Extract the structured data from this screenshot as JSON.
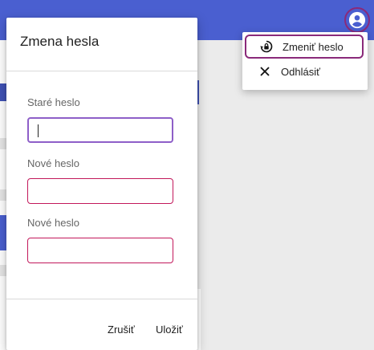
{
  "app": {
    "title": "",
    "account_icon": "account-circle-icon"
  },
  "dialog": {
    "title": "Zmena hesla",
    "fields": [
      {
        "label": "Staré heslo",
        "value": ""
      },
      {
        "label": "Nové heslo",
        "value": ""
      },
      {
        "label": "Nové heslo",
        "value": ""
      }
    ],
    "cancel_label": "Zrušiť",
    "save_label": "Uložiť"
  },
  "menu": {
    "items": [
      {
        "label": "Zmeniť heslo",
        "icon": "lock-reset-icon"
      },
      {
        "label": "Odhlásiť",
        "icon": "close-icon"
      }
    ]
  },
  "colors": {
    "topbar": "#4a5fd0",
    "field_border": "#c2185b",
    "focus_border": "#8e5fc8",
    "highlight": "#8a2a7a"
  }
}
